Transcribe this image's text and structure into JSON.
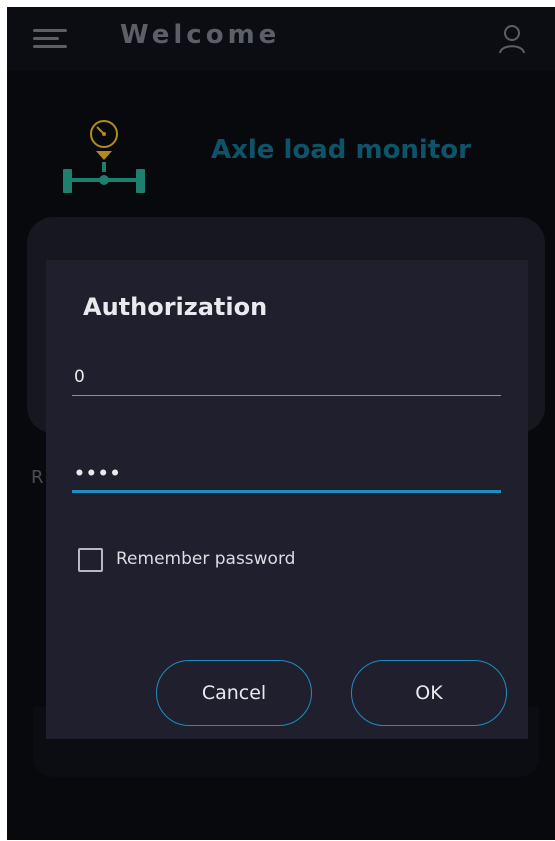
{
  "header": {
    "title": "Welcome",
    "menu_icon": "hamburger-menu-icon",
    "user_icon": "user-icon"
  },
  "app": {
    "title": "Axle load monitor",
    "logo_icon": "axle-gauge-logo-icon"
  },
  "background": {
    "partial_label": "R"
  },
  "dialog": {
    "title": "Authorization",
    "username_value": "0",
    "password_value": "••••",
    "remember_label": "Remember password",
    "remember_checked": false,
    "cancel_label": "Cancel",
    "ok_label": "OK"
  },
  "colors": {
    "accent": "#1f8dc0",
    "background": "#08090d",
    "dialog_background": "#201f2e",
    "logo_teal": "#1f7f6f",
    "logo_gold": "#b08a1a"
  }
}
